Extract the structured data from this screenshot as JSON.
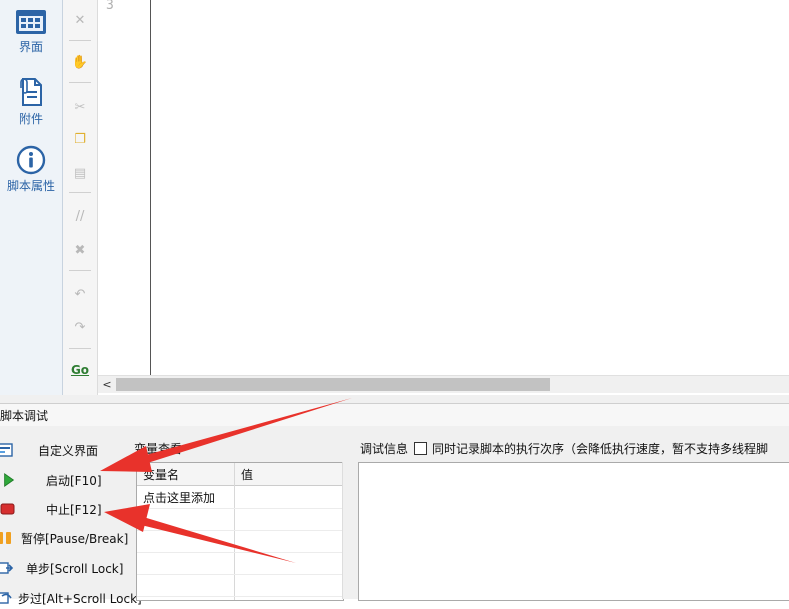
{
  "sidebar": {
    "items": [
      {
        "label": "界面",
        "icon": "grid-window-icon"
      },
      {
        "label": "附件",
        "icon": "attachment-document-icon"
      },
      {
        "label": "脚本属性",
        "icon": "info-icon"
      }
    ]
  },
  "toolbar": {
    "go_label": "Go"
  },
  "editor": {
    "line_number": "3"
  },
  "bottom_panel": {
    "title": "脚本调试",
    "controls": [
      {
        "label": "自定义界面",
        "icon": "custom-ui-icon"
      },
      {
        "label": "启动[F10]",
        "icon": "play-icon"
      },
      {
        "label": "中止[F12]",
        "icon": "stop-icon"
      },
      {
        "label": "暂停[Pause/Break]",
        "icon": "pause-icon"
      },
      {
        "label": "单步[Scroll Lock]",
        "icon": "step-icon"
      },
      {
        "label": "步过[Alt+Scroll Lock]",
        "icon": "step-over-icon"
      }
    ],
    "variables": {
      "title": "变量查看",
      "columns": [
        "变量名",
        "值"
      ],
      "add_row": "点击这里添加"
    },
    "debug": {
      "title": "调试信息",
      "checkbox_label": "同时记录脚本的执行次序（会降低执行速度，暂不支持多线程脚",
      "checked": false
    }
  },
  "colors": {
    "sidebar_bg": "#eef3f8",
    "sidebar_text": "#2c64a6",
    "arrow": "#e8322b",
    "play": "#2fa83a",
    "stop": "#d62f2f",
    "pause": "#f0a020"
  }
}
